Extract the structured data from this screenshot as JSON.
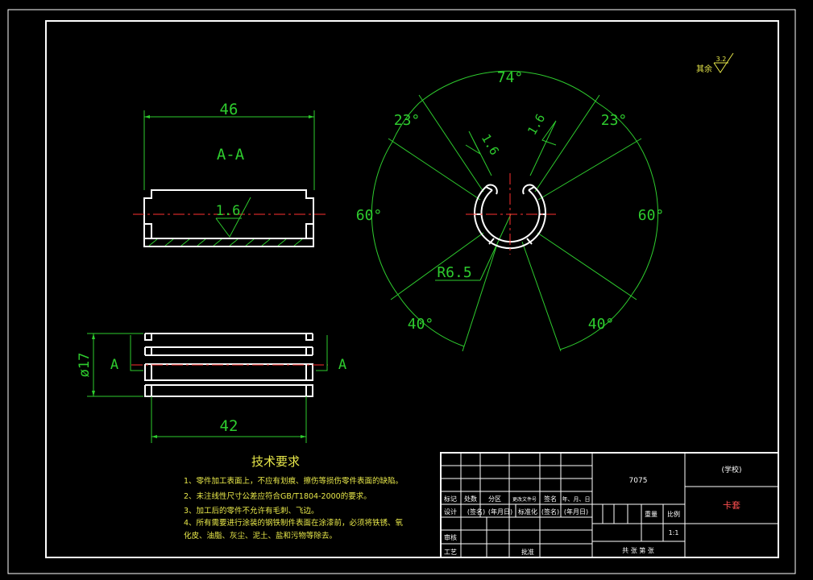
{
  "drawing": {
    "section_label": "A-A",
    "dims": {
      "top_width": "46",
      "bottom_width": "42",
      "diameter": "ø17",
      "surface_roughness_section": "1.6",
      "radius": "R6.5",
      "angle_top": "74°",
      "angle_top_left": "23°",
      "angle_top_right": "23°",
      "angle_left": "60°",
      "angle_right": "60°",
      "angle_bottom_left": "40°",
      "angle_bottom_right": "40°",
      "roughness_left": "1.6",
      "roughness_right": "1.6"
    },
    "section_marks": {
      "left": "A",
      "right": "A"
    },
    "remaining_roughness": {
      "label": "其余",
      "value": "3.2"
    }
  },
  "tech_requirements": {
    "title": "技术要求",
    "items": [
      "1、零件加工表面上，不应有划痕、擦伤等损伤零件表面的缺陷。",
      "2、未注线性尺寸公差应符合GB/T1804-2000的要求。",
      "3、加工后的零件不允许有毛刺、飞边。",
      "4、所有需要进行涂装的钢铁制件表面在涂漆前，必须将铁锈、氧",
      "化皮、油脂、灰尘、泥土、盐和污物等除去。"
    ]
  },
  "title_block": {
    "material": "7075",
    "school": "(学校)",
    "part_name": "卡套",
    "row_labels_1": [
      "标记",
      "处数",
      "分区",
      "更改文件号",
      "签名",
      "年、月、日"
    ],
    "row_labels_2": [
      "设计",
      "(签名)",
      "(年月日)",
      "标准化",
      "(签名)",
      "(年月日)"
    ],
    "review": "审核",
    "process": "工艺",
    "approve": "批准",
    "weight": "重量",
    "scale": "比例",
    "scale_value": "1:1",
    "sheets": "共 张 第 张"
  }
}
